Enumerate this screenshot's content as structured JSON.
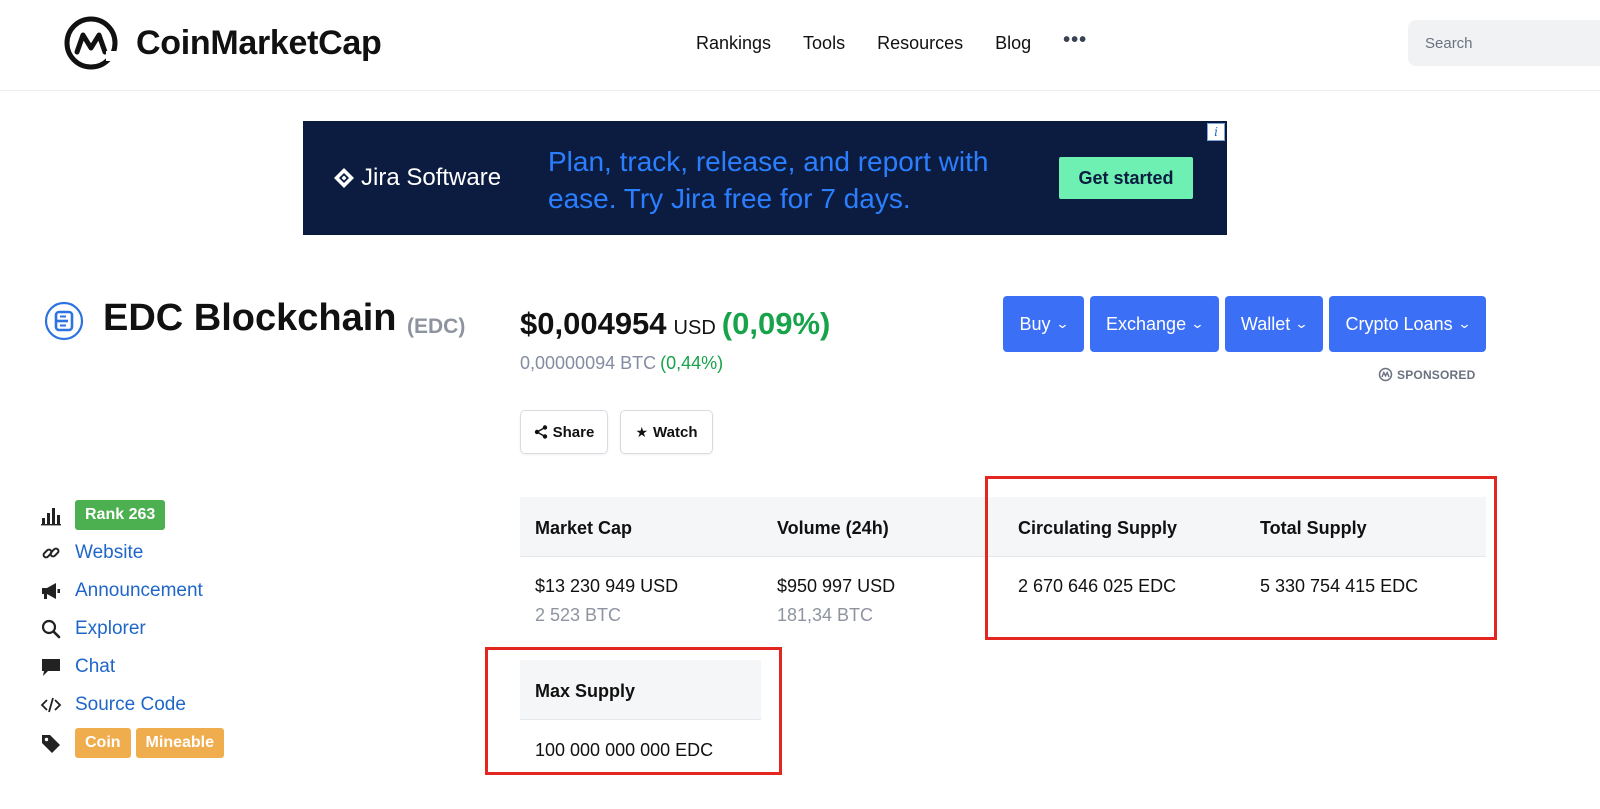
{
  "header": {
    "brand": "CoinMarketCap",
    "nav": [
      "Rankings",
      "Tools",
      "Resources",
      "Blog"
    ],
    "more": "•••",
    "search_placeholder": "Search"
  },
  "ad": {
    "brand": "Jira Software",
    "headline": "Plan, track, release, and report with ease. Try Jira free for 7 days.",
    "cta": "Get started",
    "info": "i"
  },
  "coin": {
    "name": "EDC Blockchain",
    "symbol": "(EDC)",
    "price": "$0,004954",
    "price_unit": "USD",
    "price_change": "(0,09%)",
    "btc_price": "0,00000094 BTC",
    "btc_change": "(0,44%)",
    "accent_positive": "#16a34a"
  },
  "actions": {
    "share": "Share",
    "watch": "Watch"
  },
  "dropdowns": {
    "buy": "Buy",
    "exchange": "Exchange",
    "wallet": "Wallet",
    "loans": "Crypto Loans",
    "sponsored": "SPONSORED",
    "color": "#3b6ff5"
  },
  "sidebar": {
    "rank": "Rank 263",
    "links": [
      "Website",
      "Announcement",
      "Explorer",
      "Chat",
      "Source Code"
    ],
    "tags": [
      "Coin",
      "Mineable"
    ],
    "icons": [
      "bar-chart-icon",
      "link-icon",
      "megaphone-icon",
      "search-icon",
      "chat-bubble-icon",
      "code-icon",
      "tag-icon"
    ]
  },
  "stats": {
    "headers": [
      "Market Cap",
      "Volume (24h)",
      "Circulating Supply",
      "Total Supply",
      "Max Supply"
    ],
    "market_cap": "$13 230 949 USD",
    "market_cap_btc": "2 523 BTC",
    "volume": "$950 997 USD",
    "volume_btc": "181,34 BTC",
    "circulating": "2 670 646 025 EDC",
    "total": "5 330 754 415 EDC",
    "max": "100 000 000 000 EDC"
  }
}
